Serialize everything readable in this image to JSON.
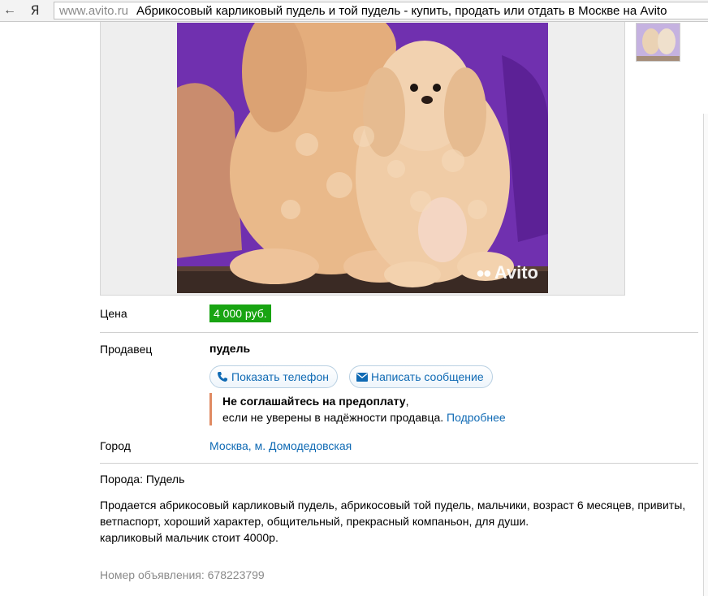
{
  "browser": {
    "back_icon": "←",
    "yandex_icon": "Я",
    "url": "www.avito.ru",
    "tab_title": "Абрикосовый карликовый пудель и той пудель - купить, продать или отдать в Москве на Avito"
  },
  "photo": {
    "watermark": "Avito",
    "background_color": "#6a2aa8"
  },
  "listing": {
    "price_label": "Цена",
    "price": "4 000 руб.",
    "price_color": "#18a412",
    "seller_label": "Продавец",
    "seller_name": "пудель",
    "show_phone_button": "Показать телефон",
    "write_message_button": "Написать сообщение",
    "warning_title": "Не соглашайтесь на предоплату",
    "warning_comma": ",",
    "warning_text": "если не уверены в надёжности продавца.",
    "warning_link": "Подробнее",
    "city_label": "Город",
    "city_value": "Москва, м. Домодедовская",
    "breed": "Порода: Пудель",
    "description_lines": [
      "Продается абрикосовый карликовый пудель, абрикосовый той пудель, мальчики, возраст 6 месяцев, привиты,",
      "ветпаспорт, хороший характер, общительный, прекрасный компаньон, для души.",
      "карликовый мальчик стоит 4000р."
    ],
    "ad_number": "Номер объявления: 678223799"
  }
}
